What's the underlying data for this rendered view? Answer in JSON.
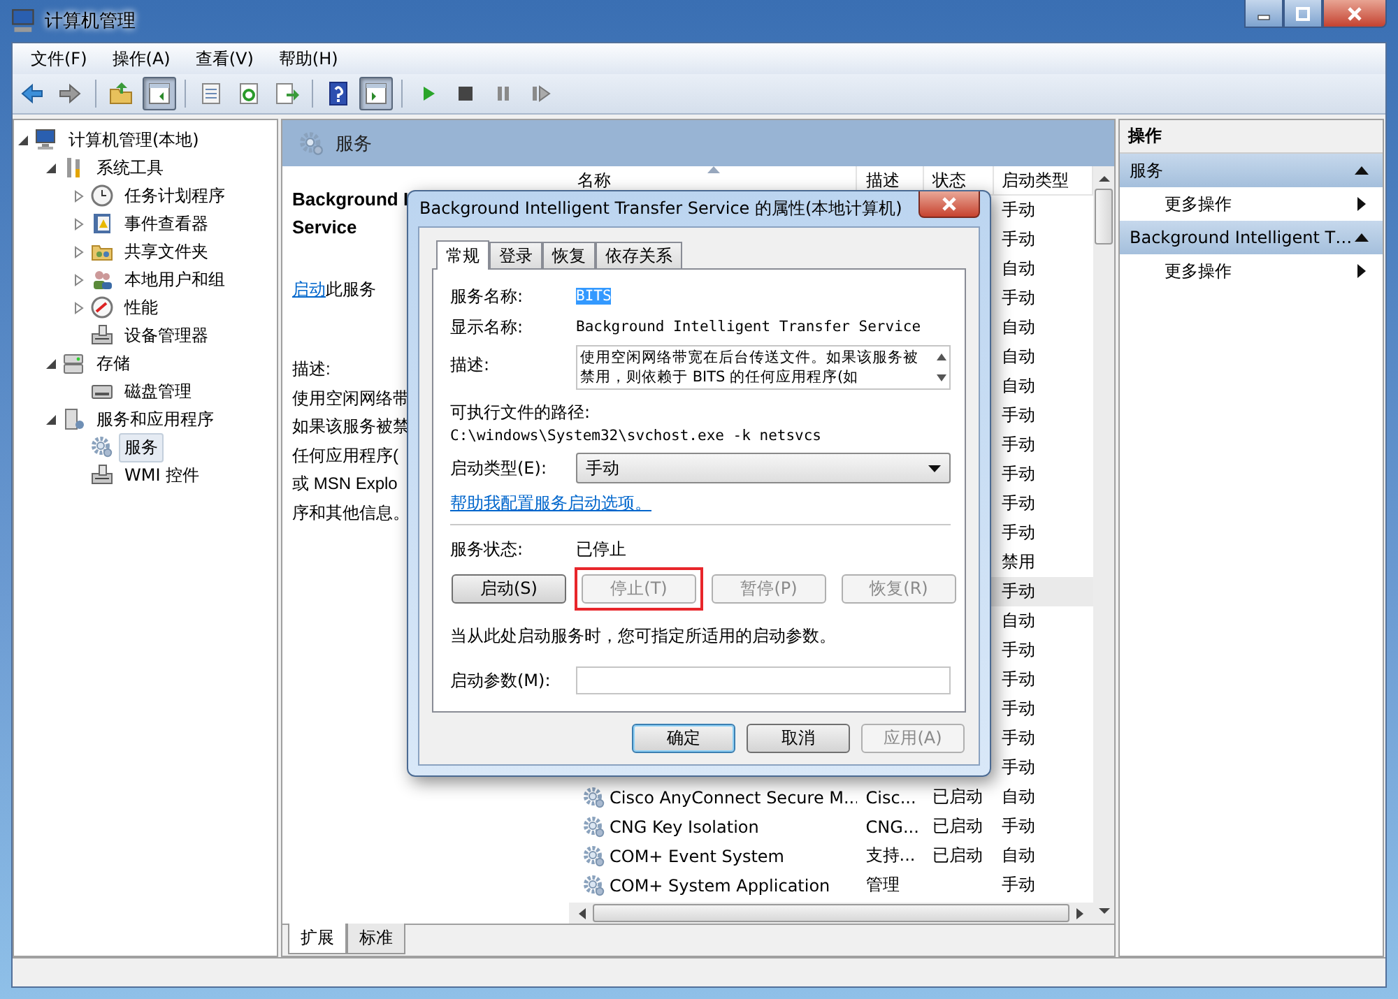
{
  "window": {
    "title": "计算机管理"
  },
  "menu": [
    "文件(F)",
    "操作(A)",
    "查看(V)",
    "帮助(H)"
  ],
  "toolbar": [
    {
      "kind": "back",
      "pressed": false
    },
    {
      "kind": "forward",
      "pressed": false
    },
    {
      "kind": "separator"
    },
    {
      "kind": "up",
      "pressed": false
    },
    {
      "kind": "tree-toggle",
      "pressed": true
    },
    {
      "kind": "separator"
    },
    {
      "kind": "properties",
      "pressed": false
    },
    {
      "kind": "refresh",
      "pressed": false
    },
    {
      "kind": "export",
      "pressed": false
    },
    {
      "kind": "separator"
    },
    {
      "kind": "help",
      "pressed": false
    },
    {
      "kind": "pane-toggle",
      "pressed": true
    },
    {
      "kind": "separator"
    },
    {
      "kind": "start",
      "pressed": false
    },
    {
      "kind": "stop",
      "pressed": false
    },
    {
      "kind": "pause",
      "pressed": false
    },
    {
      "kind": "resume",
      "pressed": false
    }
  ],
  "tree": [
    {
      "label": "计算机管理(本地)",
      "selected": false,
      "expanded": true,
      "children": [
        {
          "label": "系统工具",
          "selected": false,
          "expanded": true,
          "children": [
            {
              "label": "任务计划程序",
              "selected": false,
              "expanded": false
            },
            {
              "label": "事件查看器",
              "selected": false,
              "expanded": false
            },
            {
              "label": "共享文件夹",
              "selected": false,
              "expanded": false
            },
            {
              "label": "本地用户和组",
              "selected": false,
              "expanded": false
            },
            {
              "label": "性能",
              "selected": false,
              "expanded": false
            },
            {
              "label": "设备管理器",
              "selected": false
            }
          ]
        },
        {
          "label": "存储",
          "selected": false,
          "expanded": true,
          "children": [
            {
              "label": "磁盘管理",
              "selected": false
            }
          ]
        },
        {
          "label": "服务和应用程序",
          "selected": false,
          "expanded": true,
          "children": [
            {
              "label": "服务",
              "selected": true
            },
            {
              "label": "WMI 控件",
              "selected": false
            }
          ]
        }
      ]
    }
  ],
  "services_panel": {
    "title": "服务",
    "detail": {
      "name_lines": [
        "Background I",
        "Service"
      ],
      "link": "启动",
      "link_suffix": "此服务",
      "description_label": "描述:",
      "description_lines": [
        "使用空闲网络带",
        "如果该服务被禁",
        "任何应用程序(",
        "或 MSN Explo",
        "序和其他信息。"
      ]
    },
    "columns": [
      {
        "label": "名称",
        "sorted": true
      },
      {
        "label": "描述",
        "sorted": false
      },
      {
        "label": "状态",
        "sorted": false
      },
      {
        "label": "启动类型",
        "sorted": false
      }
    ],
    "rows": [
      {
        "startup": "手动",
        "selected": false
      },
      {
        "startup": "手动",
        "selected": false
      },
      {
        "startup": "自动",
        "selected": false
      },
      {
        "startup": "手动",
        "selected": false
      },
      {
        "startup": "自动",
        "selected": false
      },
      {
        "startup": "自动",
        "selected": false
      },
      {
        "startup": "自动",
        "selected": false
      },
      {
        "startup": "手动",
        "selected": false
      },
      {
        "startup": "手动",
        "selected": false
      },
      {
        "startup": "手动",
        "selected": false
      },
      {
        "startup": "手动",
        "selected": false
      },
      {
        "startup": "手动",
        "selected": false
      },
      {
        "startup": "禁用",
        "selected": false
      },
      {
        "startup": "手动",
        "selected": true
      },
      {
        "startup": "自动",
        "selected": false
      },
      {
        "startup": "手动",
        "selected": false
      },
      {
        "startup": "手动",
        "selected": false
      },
      {
        "startup": "手动",
        "selected": false
      },
      {
        "startup": "手动",
        "selected": false
      },
      {
        "startup": "手动",
        "selected": false
      },
      {
        "name": "Cisco AnyConnect Secure M...",
        "description": "Cisc...",
        "status": "已启动",
        "startup": "自动",
        "selected": false
      },
      {
        "name": "CNG Key Isolation",
        "description": "CNG...",
        "status": "已启动",
        "startup": "手动",
        "selected": false
      },
      {
        "name": "COM+ Event System",
        "description": "支持...",
        "status": "已启动",
        "startup": "自动",
        "selected": false
      },
      {
        "name": "COM+ System Application",
        "description": "管理",
        "startup": "手动",
        "selected": false
      }
    ],
    "bottom_tabs": [
      {
        "label": "扩展",
        "selected": true
      },
      {
        "label": "标准",
        "selected": false
      }
    ]
  },
  "actions": {
    "title": "操作",
    "sections": [
      {
        "title": "服务",
        "expanded": true,
        "items": [
          {
            "label": "更多操作",
            "submenu": true
          }
        ]
      },
      {
        "title": "Background Intelligent T…",
        "expanded": true,
        "items": [
          {
            "label": "更多操作",
            "submenu": true
          }
        ]
      }
    ]
  },
  "dialog": {
    "title": "Background Intelligent Transfer Service 的属性(本地计算机)",
    "tabs": [
      {
        "label": "常规",
        "selected": true
      },
      {
        "label": "登录",
        "selected": false
      },
      {
        "label": "恢复",
        "selected": false
      },
      {
        "label": "依存关系",
        "selected": false
      }
    ],
    "service_name_label": "服务名称:",
    "service_name": "BITS",
    "service_name_selected": true,
    "display_name_label": "显示名称:",
    "display_name": "Background Intelligent Transfer Service",
    "description_label": "描述:",
    "description": "使用空闲网络带宽在后台传送文件。如果该服务被禁用，则依赖于 BITS 的任何应用程序(如",
    "path_label": "可执行文件的路径:",
    "path": "C:\\windows\\System32\\svchost.exe -k netsvcs",
    "startup_type_label": "启动类型(E):",
    "startup_type": "手动",
    "help_link": "帮助我配置服务启动选项。",
    "status_label": "服务状态:",
    "status": "已停止",
    "buttons": [
      {
        "label": "启动(S)",
        "disabled": false,
        "highlighted": false
      },
      {
        "label": "停止(T)",
        "disabled": true,
        "highlighted": true
      },
      {
        "label": "暂停(P)",
        "disabled": true,
        "highlighted": false
      },
      {
        "label": "恢复(R)",
        "disabled": true,
        "highlighted": false
      }
    ],
    "hint": "当从此处启动服务时，您可指定所适用的启动参数。",
    "params_label": "启动参数(M):",
    "footer_buttons": [
      {
        "label": "确定",
        "disabled": false,
        "default": true
      },
      {
        "label": "取消",
        "disabled": false,
        "default": false
      },
      {
        "label": "应用(A)",
        "disabled": true,
        "default": false
      }
    ]
  }
}
